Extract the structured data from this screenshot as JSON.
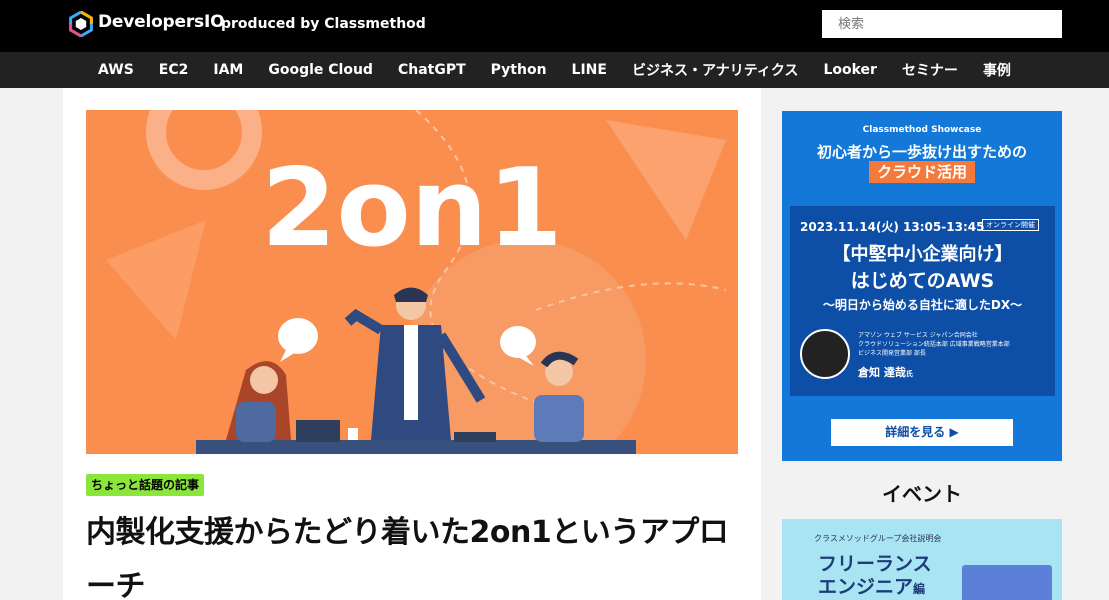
{
  "header": {
    "logo_icon": "developersio-hexagon-icon",
    "site_name": "DevelopersIO",
    "produced_by": "produced by Classmethod",
    "search_placeholder": "検索"
  },
  "nav": {
    "items": [
      "AWS",
      "EC2",
      "IAM",
      "Google Cloud",
      "ChatGPT",
      "Python",
      "LINE",
      "ビジネス・アナリティクス",
      "Looker",
      "セミナー",
      "事例"
    ]
  },
  "article": {
    "hero_text": "2on1",
    "tag": "ちょっと話題の記事",
    "title": "内製化支援からたどり着いた2on1というアプローチ"
  },
  "sidebar": {
    "ad": {
      "kicker": "Classmethod Showcase",
      "headline": "初心者から一歩抜け出すための",
      "highlight": "クラウド活用",
      "datetime": "2023.11.14(火) 13:05-13:45",
      "online_badge": "オンライン開催",
      "title_line1": "【中堅中小企業向け】",
      "title_line2": "はじめてのAWS",
      "subtitle": "〜明日から始める自社に適したDX〜",
      "speaker_affiliation_1": "アマゾン ウェブ サービス ジャパン合同会社",
      "speaker_affiliation_2": "クラウドソリューション統括本部 広域事業戦略営業本部",
      "speaker_affiliation_3": "ビジネス開発営業部 部長",
      "speaker_name": "倉知 達哉",
      "speaker_suffix": "氏",
      "cta": "詳細を見る ▶"
    },
    "events_title": "イベント",
    "event_card": {
      "kicker": "クラスメソッドグループ会社説明会",
      "line1": "フリーランス",
      "line2": "エンジニア",
      "suffix": "編"
    }
  },
  "colors": {
    "header_bg": "#000000",
    "nav_bg": "#222222",
    "hero_bg": "#f98e4f",
    "tag_bg": "#8ae63a",
    "ad_bg": "#1478d8",
    "ad_highlight": "#f47a3b"
  }
}
